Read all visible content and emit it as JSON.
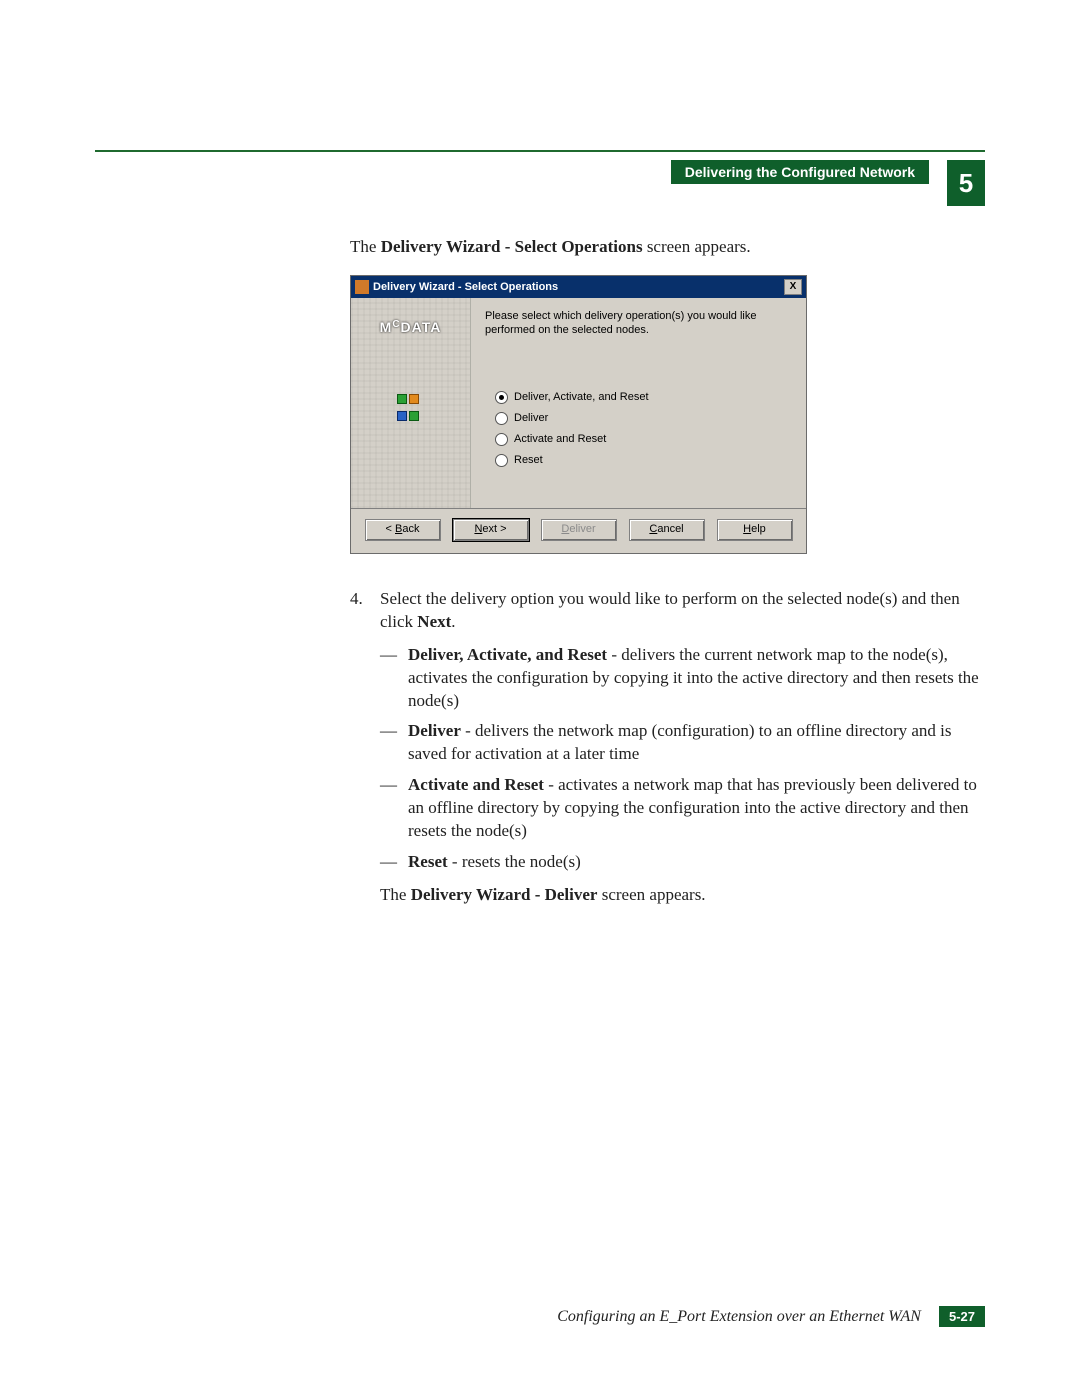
{
  "header": {
    "section_title": "Delivering the Configured Network",
    "chapter_number": "5"
  },
  "intro": {
    "prefix": "The ",
    "bold": "Delivery Wizard - Select Operations",
    "suffix": " screen appears."
  },
  "wizard": {
    "title": "Delivery Wizard - Select Operations",
    "close_glyph": "X",
    "brand_pre": "M",
    "brand_sup": "C",
    "brand_post": "DATA",
    "prompt": "Please select which delivery operation(s) you would like performed on the selected nodes.",
    "options": [
      {
        "label": "Deliver, Activate, and Reset",
        "selected": true
      },
      {
        "label": "Deliver",
        "selected": false
      },
      {
        "label": "Activate and Reset",
        "selected": false
      },
      {
        "label": "Reset",
        "selected": false
      }
    ],
    "buttons": {
      "back": "< Back",
      "next": "Next >",
      "deliver": "Deliver",
      "cancel": "Cancel",
      "help": "Help"
    },
    "mnemonics": {
      "back": "B",
      "next": "N",
      "deliver": "D",
      "cancel": "C",
      "help": "H"
    }
  },
  "step": {
    "number": "4.",
    "text_a": "Select the delivery option you would like to perform on the selected node(s) and then click ",
    "text_bold": "Next",
    "text_b": "."
  },
  "bullets": [
    {
      "bold": "Deliver, Activate, and Reset",
      "rest": " - delivers the current network map to the node(s), activates the configuration by copying it into the active directory and then resets the node(s)"
    },
    {
      "bold": "Deliver",
      "rest": " - delivers the network map (configuration) to an offline directory and is saved for activation at a later time"
    },
    {
      "bold": "Activate and Reset",
      "rest": " - activates a network map that has previously been delivered to an offline directory by copying the configuration into the active directory and then resets the node(s)"
    },
    {
      "bold": "Reset",
      "rest": " - resets the node(s)"
    }
  ],
  "outro": {
    "prefix": "The ",
    "bold": "Delivery Wizard - Deliver",
    "suffix": " screen appears."
  },
  "footer": {
    "title": "Configuring an E_Port Extension over an Ethernet WAN",
    "page": "5-27"
  }
}
